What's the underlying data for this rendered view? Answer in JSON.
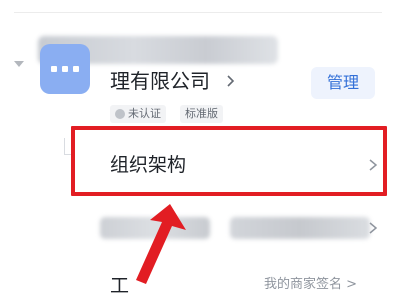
{
  "organization": {
    "name_visible": "理有限公司",
    "manage_label": "管理",
    "badges": [
      {
        "label": "未认证",
        "icon": "shield-icon"
      },
      {
        "label": "标准版"
      }
    ]
  },
  "menu": {
    "structure_label": "组织架构"
  },
  "bottom": {
    "left_label": "工",
    "right_label": "我的商家签名 >"
  },
  "colors": {
    "highlight": "#e21d23",
    "accent": "#3370d8",
    "avatar": "#8aaef2"
  }
}
